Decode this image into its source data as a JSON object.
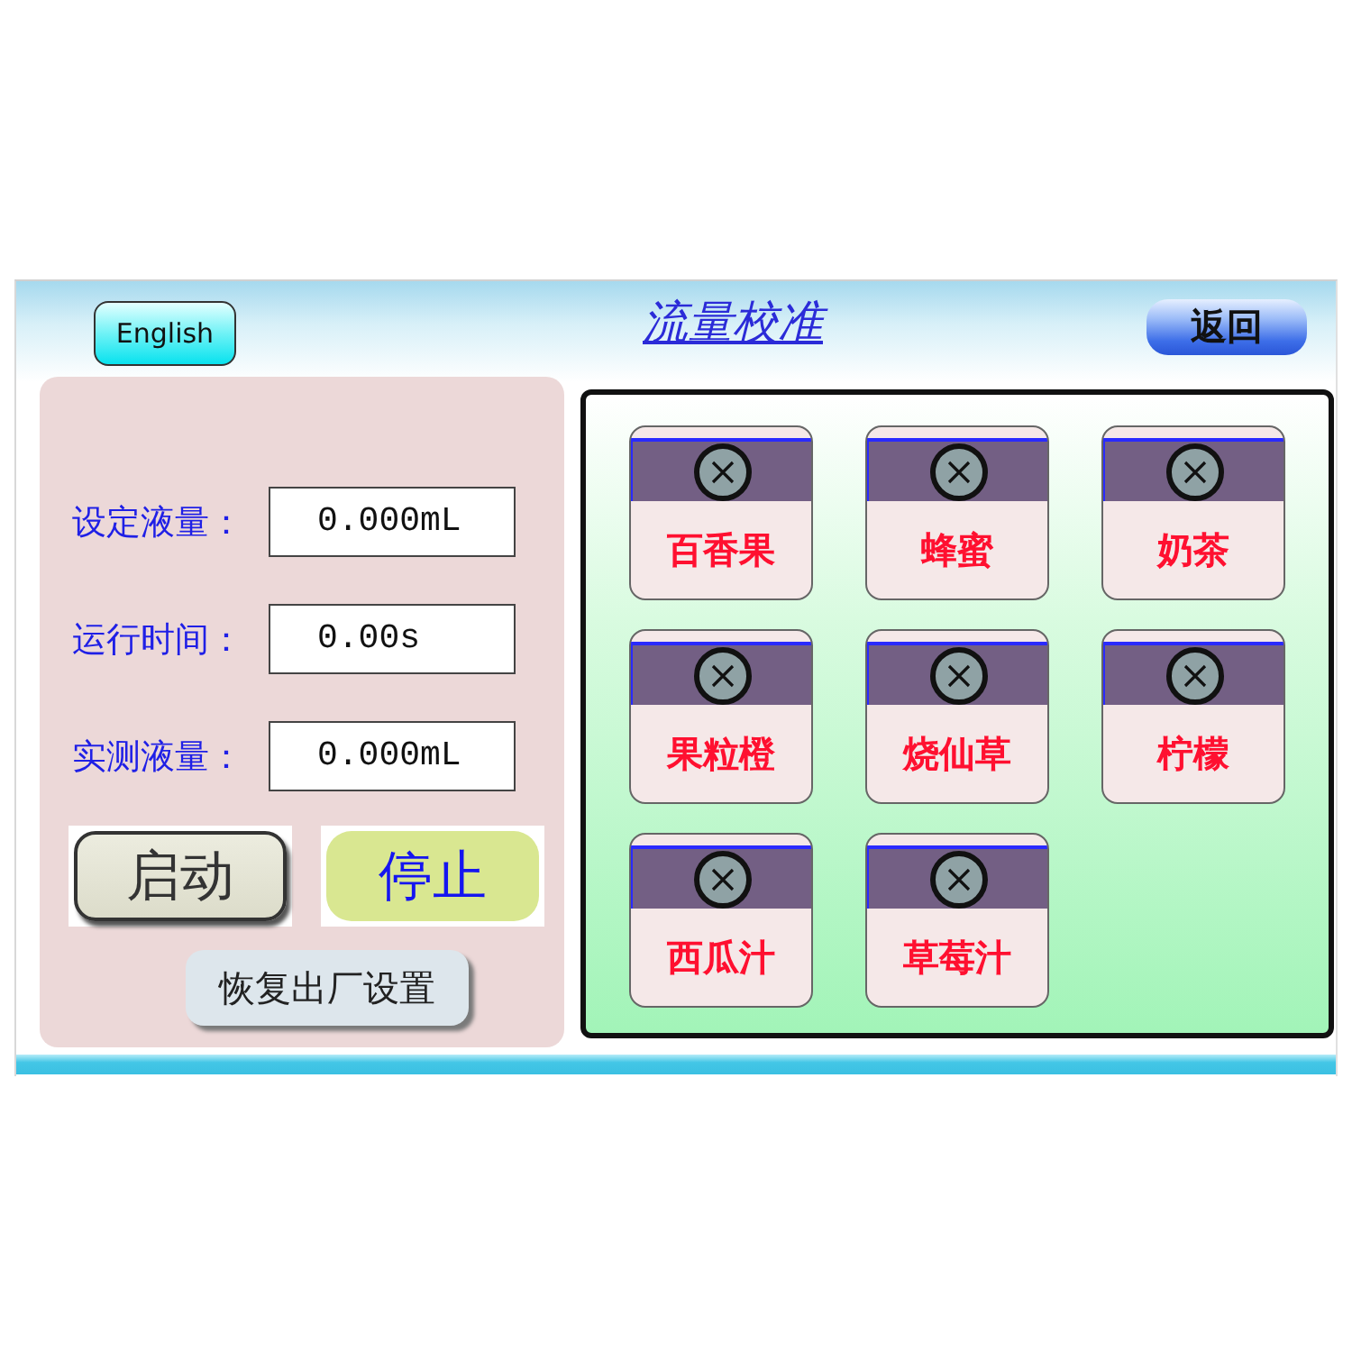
{
  "header": {
    "language_button": "English",
    "title": "流量校准",
    "back_button": "返回"
  },
  "readouts": [
    {
      "label": "设定液量：",
      "value": "0.000mL"
    },
    {
      "label": "运行时间：",
      "value": "0.00s"
    },
    {
      "label": "实测液量：",
      "value": "0.000mL"
    }
  ],
  "controls": [
    {
      "kind": "start",
      "label": "启动"
    },
    {
      "kind": "stop",
      "label": "停止"
    }
  ],
  "reset_button": "恢复出厂设置",
  "flavors": [
    "百香果",
    "蜂蜜",
    "奶茶",
    "果粒橙",
    "烧仙草",
    "柠檬",
    "西瓜汁",
    "草莓汁"
  ]
}
